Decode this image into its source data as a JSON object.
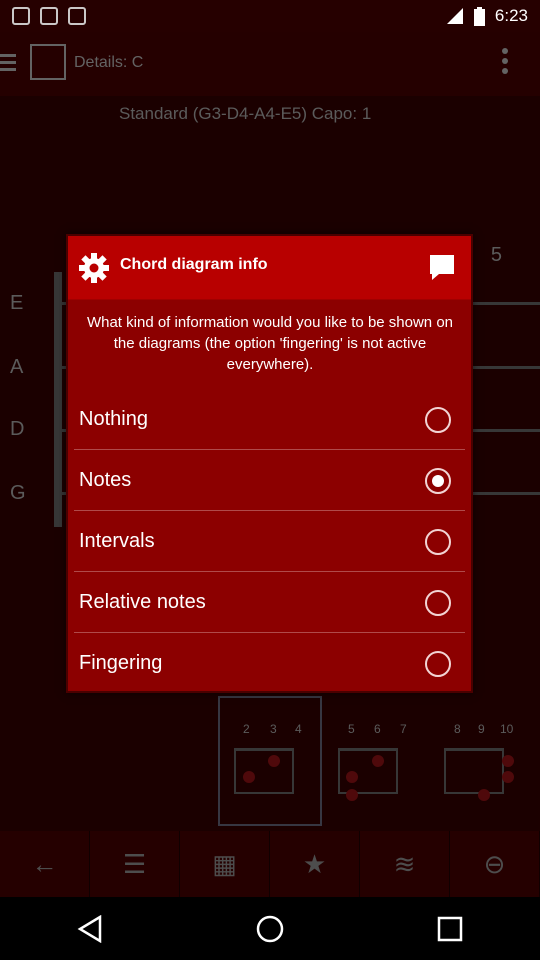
{
  "status_bar": {
    "time": "6:23",
    "battery_icon": "battery-icon",
    "signal_icon": "signal-icon"
  },
  "toolbar": {
    "title": "Details: C"
  },
  "background": {
    "tuning": "Standard (G3-D4-A4-E5)  Capo: 1",
    "string_labels": [
      "E",
      "A",
      "D",
      "G"
    ],
    "fret_number": "5",
    "diagram_fret_numbers": [
      "2",
      "3",
      "4",
      "5",
      "6",
      "7",
      "8",
      "9",
      "10"
    ]
  },
  "dialog": {
    "title": "Chord diagram info",
    "prompt": "What kind of information would you like to be shown on the diagrams (the option 'fingering' is not active everywhere).",
    "options": [
      {
        "label": "Nothing",
        "selected": false
      },
      {
        "label": "Notes",
        "selected": true
      },
      {
        "label": "Intervals",
        "selected": false
      },
      {
        "label": "Relative notes",
        "selected": false
      },
      {
        "label": "Fingering",
        "selected": false
      }
    ]
  },
  "bottom_tabs": [
    {
      "icon": "back-arrow-icon",
      "glyph": "←"
    },
    {
      "icon": "list-icon",
      "glyph": "☰"
    },
    {
      "icon": "grid-icon",
      "glyph": "▦"
    },
    {
      "icon": "star-icon",
      "glyph": "★"
    },
    {
      "icon": "strum-icon",
      "glyph": "≋"
    },
    {
      "icon": "tuner-icon",
      "glyph": "⊖"
    }
  ],
  "nav_bar": [
    "back-icon",
    "home-icon",
    "recents-icon"
  ],
  "colors": {
    "dialog_header": "#b80000",
    "dialog_body": "#8c0000",
    "background": "#2a0000"
  }
}
